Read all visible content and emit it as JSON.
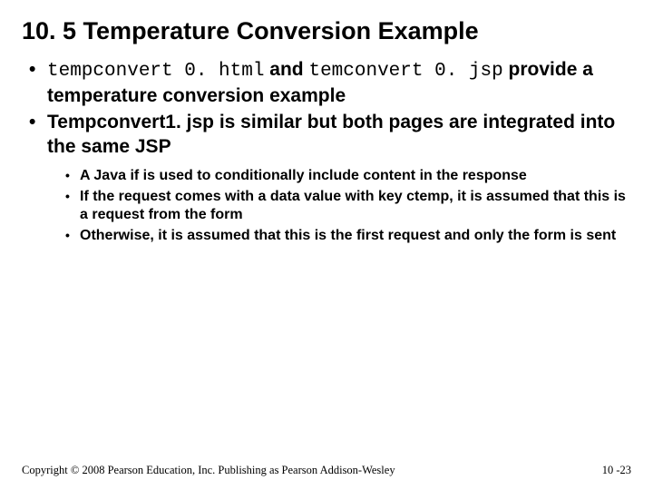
{
  "title": "10. 5 Temperature Conversion Example",
  "bullets": [
    {
      "parts": [
        {
          "text": "tempconvert 0. html",
          "mono": true
        },
        {
          "text": " and ",
          "mono": false
        },
        {
          "text": "temconvert 0. jsp",
          "mono": true
        },
        {
          "text": " provide a temperature conversion example",
          "mono": false
        }
      ],
      "sub": []
    },
    {
      "parts": [
        {
          "text": "Tempconvert1. jsp is similar but both pages are integrated into the same JSP",
          "mono": false
        }
      ],
      "sub": [
        "A Java if is used to conditionally include content in the response",
        "If the request comes with a data value with key ctemp, it is assumed that this is a request from the form",
        "Otherwise, it is assumed that this is the first request and only the form is sent"
      ]
    }
  ],
  "footer": {
    "copyright": "Copyright © 2008 Pearson Education, Inc. Publishing as Pearson Addison-Wesley",
    "pagenum": "10 -23"
  }
}
